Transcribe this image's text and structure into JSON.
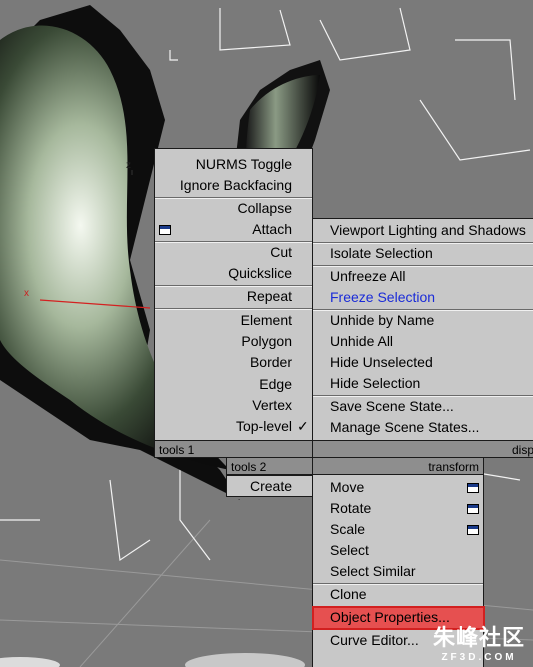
{
  "viewport": {
    "x_axis": "x",
    "z_axis": "z"
  },
  "quad_tl": {
    "items": [
      "NURMS Toggle",
      "Ignore Backfacing",
      "Collapse",
      "Attach",
      "Cut",
      "Quickslice",
      "Repeat",
      "Element",
      "Polygon",
      "Border",
      "Edge",
      "Vertex",
      "Top-level"
    ],
    "header": "tools 1"
  },
  "quad_tr": {
    "items": [
      "Viewport Lighting and Shadows",
      "Isolate Selection",
      "Unfreeze All",
      "Freeze Selection",
      "Unhide by Name",
      "Unhide All",
      "Hide Unselected",
      "Hide Selection",
      "Save Scene State...",
      "Manage Scene States..."
    ],
    "header": "disp"
  },
  "quad_bl": {
    "header": "tools 2",
    "items": [
      "Create"
    ]
  },
  "quad_br": {
    "header": "transform",
    "items": [
      "Move",
      "Rotate",
      "Scale",
      "Select",
      "Select Similar",
      "Clone",
      "Object Properties...",
      "Curve Editor..."
    ]
  },
  "watermark": {
    "brand": "朱峰社区",
    "site": "ZF3D.COM"
  },
  "colors": {
    "highlight": "#e65050",
    "blue_item": "#1a2bd8",
    "menu_bg": "#c8c8c8",
    "viewport_bg": "#7a7a7a"
  }
}
